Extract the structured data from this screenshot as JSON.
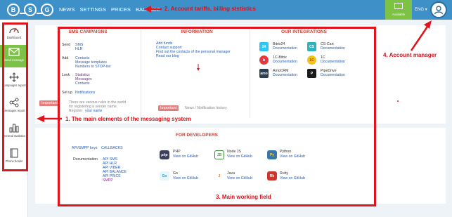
{
  "logo": {
    "letters": [
      "B",
      "S",
      "G"
    ]
  },
  "nav": {
    "items": [
      "NEWS",
      "SETTINGS",
      "PRICES",
      "BALANCE"
    ]
  },
  "header": {
    "wallet_label": "Available",
    "language": "ENG ▾"
  },
  "sidebar": {
    "items": [
      {
        "label": "Dashboard",
        "icon": "speedometer-icon"
      },
      {
        "label": "Send message",
        "icon": "envelope-icon"
      },
      {
        "label": "Campaigns report",
        "icon": "arrows-move-icon"
      },
      {
        "label": "Messages report",
        "icon": "share-icon"
      },
      {
        "label": "General statistics",
        "icon": "bar-chart-icon"
      },
      {
        "label": "Phone books",
        "icon": "phone-book-icon"
      }
    ]
  },
  "sms": {
    "title": "SMS CAMPAIGNS",
    "send_label": "Send",
    "send_links": [
      "SMS",
      "HLR"
    ],
    "add_label": "Add",
    "add_links": [
      "Contacts",
      "Message templates",
      "Numbers to STOP-list"
    ],
    "look_label": "Look",
    "look_links": [
      "Statistics",
      "Messages",
      "Contacts"
    ],
    "setup_label": "Set up",
    "setup_link": "Notifications",
    "important_badge": "Important",
    "important_lines": [
      "There are various rules in the world",
      "for registering a sender name."
    ],
    "register_text": "Register",
    "register_link": "your name"
  },
  "info": {
    "title": "INFORMATION",
    "links": [
      "Add funds",
      "Contact support",
      "Find out the contacts of the personal manager",
      "Read our blog"
    ],
    "important_badge": "Important",
    "history_text": "News / Notification history"
  },
  "integrations": {
    "title": "OUR INTEGRATIONS",
    "items": [
      {
        "name": "Bitrix24",
        "doc": "Documentation",
        "icon": "24",
        "color": "#2fc6f6"
      },
      {
        "name": "CS-Cart",
        "doc": "Documentation",
        "icon": "CS",
        "color": "#2bb3c0"
      },
      {
        "name": "1C-Bitrix",
        "doc": "Documentation",
        "icon": "b",
        "color": "#e8363c"
      },
      {
        "name": "1C",
        "doc": "Documentation",
        "icon": "1C",
        "color": "#f0c419"
      },
      {
        "name": "AmoCRM",
        "doc": "Documentation",
        "icon": "amo",
        "color": "#2c3e50"
      },
      {
        "name": "PipeDrive",
        "doc": "Documentation",
        "icon": "P",
        "color": "#1a1a1a"
      }
    ]
  },
  "developers": {
    "title": "FOR DEVELOPERS",
    "keys_text": "API/SMPP keys",
    "callbacks": "CALLBACKS",
    "doc_label": "Documentation",
    "doc_links": [
      "API SMS",
      "API HLR",
      "API VIBER",
      "API BALANCE",
      "API PRICE",
      "SMPP"
    ],
    "libs": [
      {
        "name": "PHP",
        "link": "View on GitHub",
        "icon": "php"
      },
      {
        "name": "Node JS",
        "link": "View on GitHub",
        "icon": "JS"
      },
      {
        "name": "Python",
        "link": "View on GitHub",
        "icon": "Py"
      },
      {
        "name": "Go",
        "link": "View on GitHub",
        "icon": "Go"
      },
      {
        "name": "Java",
        "link": "View on GitHub",
        "icon": "J"
      },
      {
        "name": "Ruby",
        "link": "View on GitHub",
        "icon": "Rb"
      }
    ]
  },
  "annotations": {
    "a1": "1. The main elements of the messaging system",
    "a2": "2. Account tariffs, billing ststistics",
    "a3": "3. Main working field",
    "a4": "4. Account manager"
  },
  "colors": {
    "header": "#3e90c9",
    "accent_green": "#7dc244",
    "annotation_red": "#e0141c",
    "title_red": "#d23a2e",
    "link_blue": "#2a5db0"
  }
}
